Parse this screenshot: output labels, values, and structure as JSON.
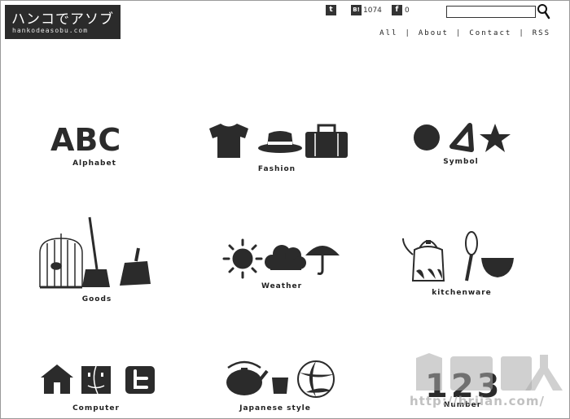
{
  "header": {
    "logo_title": "ハンコでアソブ",
    "logo_url": "hankodeasobu.com",
    "social": {
      "twitter_glyph": "t",
      "hatena_glyph": "B!",
      "hatena_count": "1074",
      "facebook_glyph": "f",
      "facebook_count": "0"
    },
    "search": {
      "value": "",
      "placeholder": ""
    },
    "nav": {
      "all": "All",
      "about": "About",
      "contact": "Contact",
      "rss": "RSS",
      "separator": "|"
    }
  },
  "categories": [
    {
      "label": "Alphabet",
      "letters": "ABC",
      "icons": [
        "letter-a-icon",
        "letter-b-icon",
        "letter-c-icon"
      ]
    },
    {
      "label": "Fashion",
      "icons": [
        "tshirt-icon",
        "hat-icon",
        "suitcase-icon"
      ]
    },
    {
      "label": "Symbol",
      "icons": [
        "circle-icon",
        "triangle-icon",
        "star-icon"
      ]
    },
    {
      "label": "Goods",
      "icons": [
        "birdcage-icon",
        "broom-icon",
        "dustpan-icon"
      ]
    },
    {
      "label": "Weather",
      "icons": [
        "sun-icon",
        "cloud-icon",
        "umbrella-icon"
      ]
    },
    {
      "label": "kitchenware",
      "icons": [
        "kettle-icon",
        "whisk-icon",
        "bowl-icon"
      ]
    },
    {
      "label": "Computer",
      "icons": [
        "home-icon",
        "finder-icon",
        "twitter-icon"
      ]
    },
    {
      "label": "Japanese style",
      "icons": [
        "teapot-icon",
        "teacup-icon",
        "beach-ball-icon"
      ]
    },
    {
      "label": "Number",
      "digits": "123",
      "icons": [
        "digit-1-icon",
        "digit-2-icon",
        "digit-3-icon"
      ]
    }
  ],
  "watermark": {
    "text": "http://briian.com/"
  },
  "colors": {
    "ink": "#2b2b2b",
    "background": "#ffffff"
  }
}
